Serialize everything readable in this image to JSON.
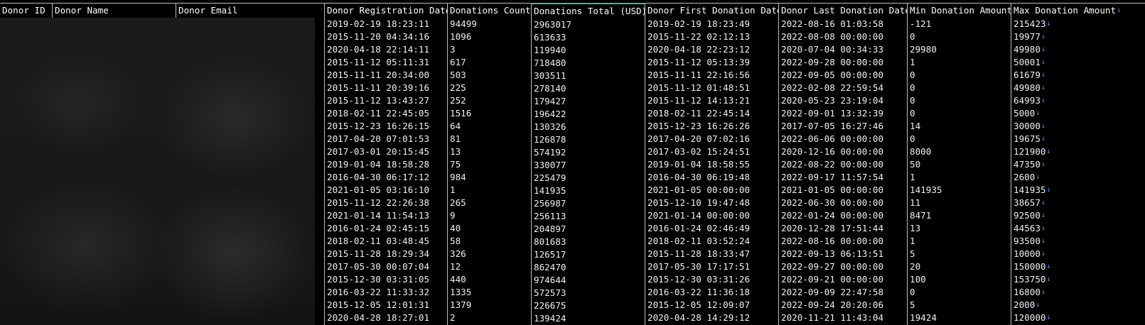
{
  "columns": [
    {
      "key": "donor_id",
      "header": "Donor ID"
    },
    {
      "key": "donor_name",
      "header": "Donor Name"
    },
    {
      "key": "donor_email",
      "header": "Donor Email"
    },
    {
      "key": "reg_date",
      "header": "Donor Registration Date"
    },
    {
      "key": "count",
      "header": "Donations Count"
    },
    {
      "key": "total",
      "header": "Donations Total (USD)"
    },
    {
      "key": "first_date",
      "header": "Donor First Donation Date"
    },
    {
      "key": "last_date",
      "header": "Donor Last Donation Date"
    },
    {
      "key": "min_amount",
      "header": "Min Donation Amount"
    },
    {
      "key": "max_amount",
      "header": "Max Donation Amount"
    }
  ],
  "sort_icon": "sort-arrow-down-icon",
  "header_accent_color": "#6fa58b",
  "sort_icon_color": "#4f8fe6",
  "rows": [
    [
      "2019-02-19 18:23:11",
      "94499",
      "2963017",
      "2019-02-19 18:23:49",
      "2022-08-16 01:03:58",
      "-121",
      "215423"
    ],
    [
      "2015-11-20 04:34:16",
      "1096",
      "613633",
      "2015-11-22 02:12:13",
      "2022-08-08 00:00:00",
      "0",
      "19977"
    ],
    [
      "2020-04-18 22:14:11",
      "3",
      "119940",
      "2020-04-18 22:23:12",
      "2020-07-04 00:34:33",
      "29980",
      "49980"
    ],
    [
      "2015-11-12 05:11:31",
      "617",
      "718480",
      "2015-11-12 05:13:39",
      "2022-09-28 00:00:00",
      "1",
      "50001"
    ],
    [
      "2015-11-11 20:34:00",
      "503",
      "303511",
      "2015-11-11 22:16:56",
      "2022-09-05 00:00:00",
      "0",
      "61679"
    ],
    [
      "2015-11-11 20:39:16",
      "225",
      "278140",
      "2015-11-12 01:48:51",
      "2022-02-08 22:59:54",
      "0",
      "49980"
    ],
    [
      "2015-11-12 13:43:27",
      "252",
      "179427",
      "2015-11-12 14:13:21",
      "2020-05-23 23:19:04",
      "0",
      "64993"
    ],
    [
      "2018-02-11 22:45:05",
      "1516",
      "196422",
      "2018-02-11 22:45:14",
      "2022-09-01 13:32:39",
      "0",
      "5000"
    ],
    [
      "2015-12-23 16:26:15",
      "64",
      "130326",
      "2015-12-23 16:26:26",
      "2017-07-05 16:27:46",
      "14",
      "30000"
    ],
    [
      "2017-04-20 07:01:53",
      "81",
      "126878",
      "2017-04-20 07:02:16",
      "2022-06-06 00:00:00",
      "0",
      "19675"
    ],
    [
      "2017-03-01 20:15:45",
      "13",
      "574192",
      "2017-03-02 15:24:51",
      "2020-12-16 00:00:00",
      "8000",
      "121900"
    ],
    [
      "2019-01-04 18:58:28",
      "75",
      "330077",
      "2019-01-04 18:58:55",
      "2022-08-22 00:00:00",
      "50",
      "47350"
    ],
    [
      "2016-04-30 06:17:12",
      "984",
      "225479",
      "2016-04-30 06:19:48",
      "2022-09-17 11:57:54",
      "1",
      "2600"
    ],
    [
      "2021-01-05 03:16:10",
      "1",
      "141935",
      "2021-01-05 00:00:00",
      "2021-01-05 00:00:00",
      "141935",
      "141935"
    ],
    [
      "2015-11-12 22:26:38",
      "265",
      "256987",
      "2015-12-10 19:47:48",
      "2022-06-30 00:00:00",
      "11",
      "38657"
    ],
    [
      "2021-01-14 11:54:13",
      "9",
      "256113",
      "2021-01-14 00:00:00",
      "2022-01-24 00:00:00",
      "8471",
      "92500"
    ],
    [
      "2016-01-24 02:45:15",
      "40",
      "204897",
      "2016-01-24 02:46:49",
      "2020-12-28 17:51:44",
      "13",
      "44563"
    ],
    [
      "2018-02-11 03:48:45",
      "58",
      "801683",
      "2018-02-11 03:52:24",
      "2022-08-16 00:00:00",
      "1",
      "93500"
    ],
    [
      "2015-11-28 18:29:34",
      "326",
      "126517",
      "2015-11-28 18:33:47",
      "2022-09-13 06:13:51",
      "5",
      "10000"
    ],
    [
      "2017-05-30 00:07:04",
      "12",
      "862470",
      "2017-05-30 17:17:51",
      "2022-09-27 00:00:00",
      "20",
      "150000"
    ],
    [
      "2015-12-30 03:31:05",
      "440",
      "974644",
      "2015-12-30 03:31:26",
      "2022-09-21 00:00:00",
      "100",
      "153750"
    ],
    [
      "2016-03-22 11:33:32",
      "1335",
      "572573",
      "2016-03-22 11:36:18",
      "2022-09-09 22:47:58",
      "0",
      "16800"
    ],
    [
      "2015-12-05 12:01:31",
      "1379",
      "226675",
      "2015-12-05 12:09:07",
      "2022-09-24 20:20:06",
      "5",
      "2000"
    ],
    [
      "2020-04-28 18:27:01",
      "2",
      "139424",
      "2020-04-28 14:29:12",
      "2020-11-21 11:43:04",
      "19424",
      "120000"
    ]
  ]
}
